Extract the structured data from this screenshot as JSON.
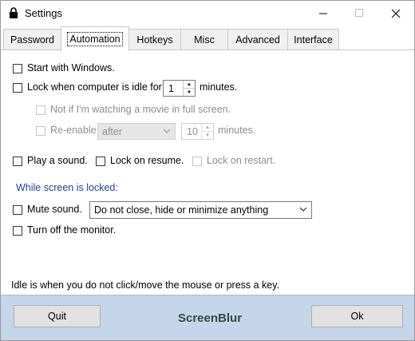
{
  "window": {
    "title": "Settings"
  },
  "tabs": [
    {
      "label": "Password"
    },
    {
      "label": "Automation"
    },
    {
      "label": "Hotkeys"
    },
    {
      "label": "Misc"
    },
    {
      "label": "Advanced"
    },
    {
      "label": "Interface"
    }
  ],
  "automation": {
    "start_windows": {
      "label": "Start with Windows.",
      "checked": false
    },
    "lock_idle": {
      "label": "Lock when computer is idle for",
      "minutes_value": "1",
      "minutes_label": "minutes.",
      "checked": false
    },
    "not_movie": {
      "label": "Not if I'm watching a movie in full screen.",
      "checked": false,
      "disabled": true
    },
    "reenable": {
      "label": "Re-enable",
      "select_value": "after",
      "minutes_value": "10",
      "minutes_label": "minutes.",
      "disabled": true
    },
    "play_sound": {
      "label": "Play a sound.",
      "checked": false
    },
    "lock_resume": {
      "label": "Lock on resume.",
      "checked": false
    },
    "lock_restart": {
      "label": "Lock on restart.",
      "checked": false,
      "disabled": true
    },
    "section_heading": "While screen is locked:",
    "mute_sound": {
      "label": "Mute sound.",
      "checked": false
    },
    "behavior_select": "Do not close, hide or minimize anything",
    "turn_off_monitor": {
      "label": "Turn off the monitor.",
      "checked": false
    },
    "idle_note": "Idle is when you do not click/move the mouse or press a key."
  },
  "footer": {
    "quit_label": "Quit",
    "brand": "ScreenBlur",
    "ok_label": "Ok"
  },
  "colors": {
    "footer_bg": "#c5d5ea",
    "section_heading": "#1b3fa8",
    "brand": "#2a4f3e"
  }
}
